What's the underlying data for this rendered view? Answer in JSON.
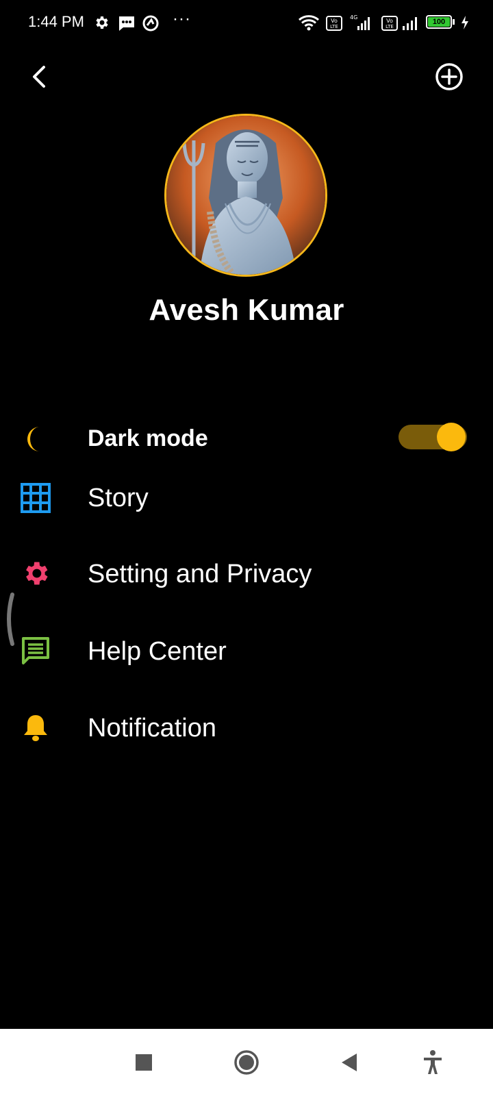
{
  "status_bar": {
    "time": "1:44 PM",
    "battery": "100",
    "icons": [
      "settings-icon",
      "message-icon",
      "vpn-icon",
      "more-dots-icon",
      "wifi-icon",
      "volte-icon",
      "4g-signal-icon",
      "volte-icon",
      "signal-icon",
      "battery-icon",
      "charging-icon"
    ]
  },
  "profile": {
    "name": "Avesh Kumar",
    "avatar": "avatar-image"
  },
  "menu": {
    "dark_mode": {
      "label": "Dark mode",
      "icon": "moon-icon",
      "enabled": true
    },
    "items": [
      {
        "label": "Story",
        "icon": "grid-icon"
      },
      {
        "label": "Setting and Privacy",
        "icon": "gear-icon"
      },
      {
        "label": "Help Center",
        "icon": "chat-icon"
      },
      {
        "label": "Notification",
        "icon": "bell-icon"
      }
    ]
  },
  "colors": {
    "accent": "#fbb90d",
    "toggle_track": "#7a5c0a",
    "story_icon": "#1e9bf0",
    "settings_icon": "#f0406e",
    "help_icon": "#7bc043",
    "background": "#000000"
  },
  "nav_bar": {
    "buttons": [
      "recents-icon",
      "home-icon",
      "back-icon",
      "accessibility-icon"
    ]
  }
}
